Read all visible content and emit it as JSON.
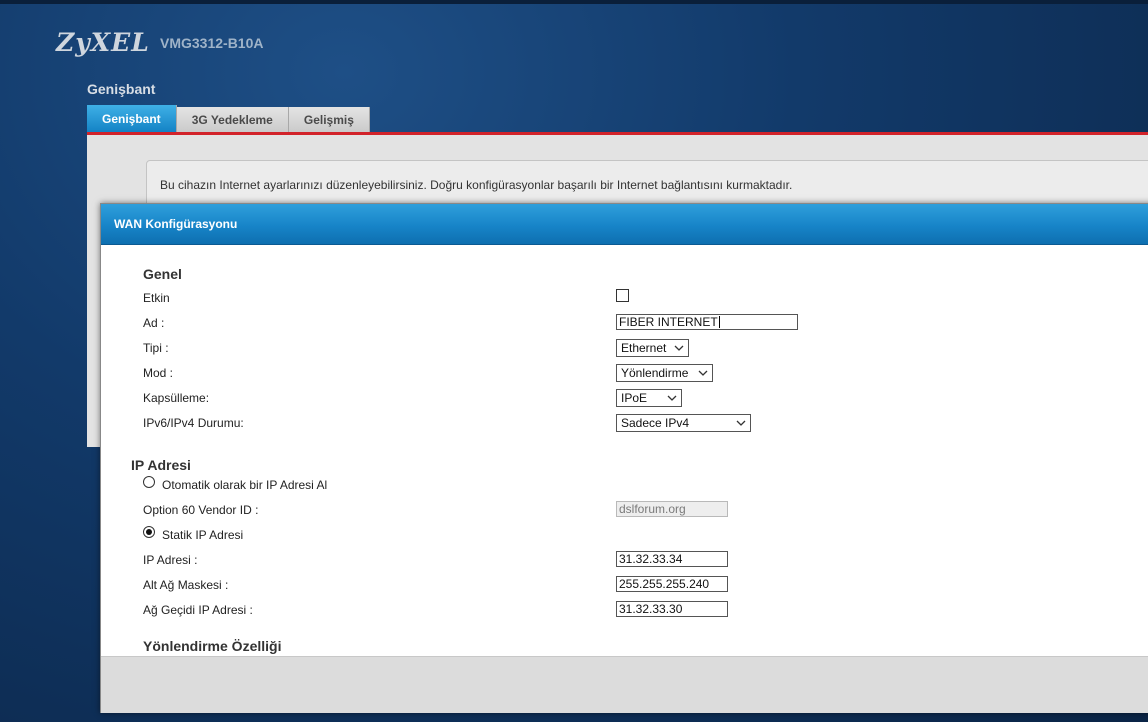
{
  "header": {
    "logo": "ZyXEL",
    "model": "VMG3312-B10A",
    "page_title": "Genişbant"
  },
  "tabs": [
    {
      "label": "Genişbant",
      "active": true
    },
    {
      "label": "3G Yedekleme",
      "active": false
    },
    {
      "label": "Gelişmiş",
      "active": false
    }
  ],
  "notice": "Bu cihazın Internet ayarlarınızı düzenleyebilirsiniz. Doğru konfigürasyonlar başarılı bir Internet bağlantısını kurmaktadır.",
  "dialog": {
    "title": "WAN Konfigürasyonu",
    "general": {
      "title": "Genel",
      "enabled_label": "Etkin",
      "enabled": false,
      "name_label": "Ad :",
      "name_value": "FIBER INTERNET",
      "type_label": "Tipi :",
      "type_value": "Ethernet",
      "mode_label": "Mod :",
      "mode_value": "Yönlendirme",
      "encap_label": "Kapsülleme:",
      "encap_value": "IPoE",
      "ipv_label": "IPv6/IPv4 Durumu:",
      "ipv_value": "Sadece IPv4"
    },
    "ip": {
      "title": "IP Adresi",
      "auto_label": "Otomatik olarak bir IP Adresi Al",
      "auto_selected": false,
      "option60_label": "Option 60 Vendor ID :",
      "option60_value": "dslforum.org",
      "static_label": "Statik IP Adresi",
      "static_selected": true,
      "ip_label": "IP Adresi :",
      "ip_value": "31.32.33.34",
      "mask_label": "Alt Ağ Maskesi :",
      "mask_value": "255.255.255.240",
      "gateway_label": "Ağ Geçidi IP Adresi :",
      "gateway_value": "31.32.33.30"
    },
    "routing": {
      "title": "Yönlendirme Özelliği"
    }
  },
  "colors": {
    "background": "#123a6a",
    "tab_active": "#1a8fd0",
    "accent_line": "#d2232a",
    "dialog_header": "#1784c8"
  }
}
